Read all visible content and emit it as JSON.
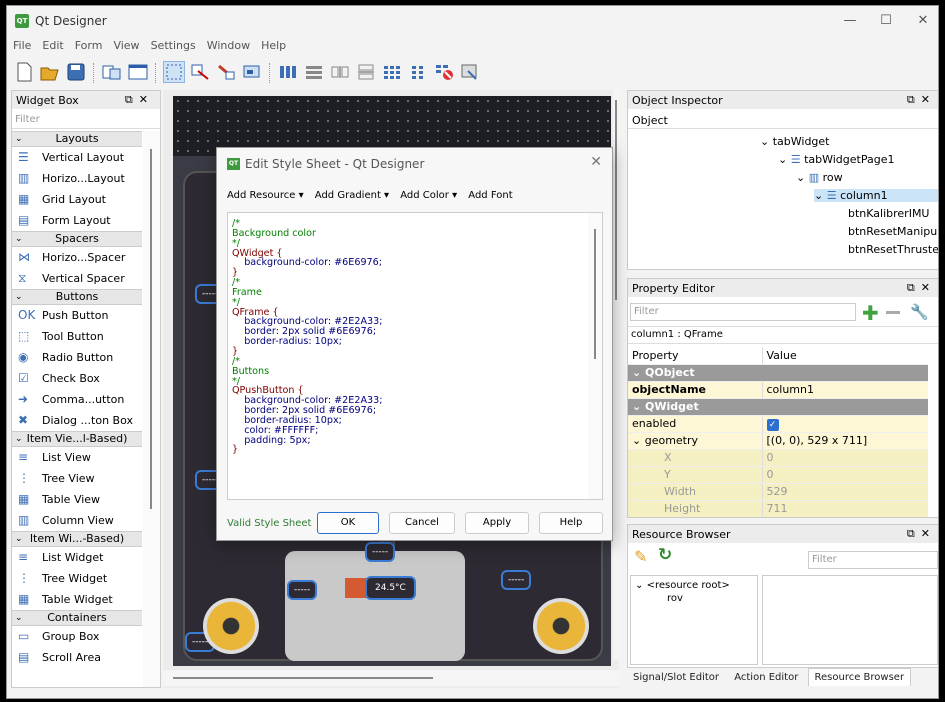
{
  "window": {
    "title": "Qt Designer",
    "minimize": "—",
    "maximize": "☐",
    "close": "✕"
  },
  "menu": [
    "File",
    "Edit",
    "Form",
    "View",
    "Settings",
    "Window",
    "Help"
  ],
  "widget_box": {
    "title": "Widget Box",
    "filter_placeholder": "Filter",
    "sections": [
      {
        "name": "Layouts",
        "items": [
          "Vertical Layout",
          "Horizo...Layout",
          "Grid Layout",
          "Form Layout"
        ]
      },
      {
        "name": "Spacers",
        "items": [
          "Horizo...Spacer",
          "Vertical Spacer"
        ]
      },
      {
        "name": "Buttons",
        "items": [
          "Push Button",
          "Tool Button",
          "Radio Button",
          "Check Box",
          "Comma...utton",
          "Dialog ...ton Box"
        ]
      },
      {
        "name": "Item Vie...l-Based)",
        "items": [
          "List View",
          "Tree View",
          "Table View",
          "Column View"
        ]
      },
      {
        "name": "Item Wi...-Based)",
        "items": [
          "List Widget",
          "Tree Widget",
          "Table Widget"
        ]
      },
      {
        "name": "Containers",
        "items": [
          "Group Box",
          "Scroll Area"
        ]
      }
    ]
  },
  "form": {
    "btn_placeholder": "-----",
    "temp": "24.5°C"
  },
  "dialog": {
    "title": "Edit Style Sheet - Qt Designer",
    "tools": [
      "Add Resource ▾",
      "Add Gradient ▾",
      "Add Color ▾",
      "Add Font"
    ],
    "valid": "Valid Style Sheet",
    "buttons": {
      "ok": "OK",
      "cancel": "Cancel",
      "apply": "Apply",
      "help": "Help"
    },
    "code": [
      [
        "c",
        "/*"
      ],
      [
        "c",
        "Background color"
      ],
      [
        "c",
        "*/"
      ],
      [
        "s",
        "QWidget {"
      ],
      [
        "p",
        "    background-color: #6E6976;"
      ],
      [
        "s",
        "}"
      ],
      [
        "c",
        "/*"
      ],
      [
        "c",
        "Frame"
      ],
      [
        "c",
        "*/"
      ],
      [
        "s",
        "QFrame {"
      ],
      [
        "p",
        "    background-color: #2E2A33;"
      ],
      [
        "p",
        "    border: 2px solid #6E6976;"
      ],
      [
        "p",
        "    border-radius: 10px;"
      ],
      [
        "s",
        "}"
      ],
      [
        "c",
        "/*"
      ],
      [
        "c",
        "Buttons"
      ],
      [
        "c",
        "*/"
      ],
      [
        "s",
        "QPushButton {"
      ],
      [
        "p",
        "    background-color: #2E2A33;"
      ],
      [
        "p",
        "    border: 2px solid #6E6976;"
      ],
      [
        "p",
        "    border-radius: 10px;"
      ],
      [
        "p",
        "    color: #FFFFFF;"
      ],
      [
        "p",
        "    padding: 5px;"
      ],
      [
        "s",
        "}"
      ]
    ]
  },
  "object_inspector": {
    "title": "Object Inspector",
    "header": "Object",
    "rows": [
      "tabWidget",
      "tabWidgetPage1",
      "row",
      "column1",
      "btnKalibrerIMU",
      "btnResetManipul",
      "btnResetThruster"
    ]
  },
  "property_editor": {
    "title": "Property Editor",
    "filter_placeholder": "Filter",
    "object_label": "column1 : QFrame",
    "col_property": "Property",
    "col_value": "Value",
    "rows": [
      {
        "type": "group",
        "name": "QObject"
      },
      {
        "type": "prop",
        "name": "objectName",
        "value": "column1",
        "bold": true
      },
      {
        "type": "group",
        "name": "QWidget"
      },
      {
        "type": "prop",
        "name": "enabled",
        "value": "",
        "check": true
      },
      {
        "type": "prop",
        "name": "geometry",
        "value": "[(0, 0), 529 x 711]",
        "expand": true
      },
      {
        "type": "sub",
        "name": "X",
        "value": "0"
      },
      {
        "type": "sub",
        "name": "Y",
        "value": "0"
      },
      {
        "type": "sub",
        "name": "Width",
        "value": "529"
      },
      {
        "type": "sub",
        "name": "Height",
        "value": "711"
      }
    ]
  },
  "resource_browser": {
    "title": "Resource Browser",
    "filter_placeholder": "Filter",
    "root": "<resource root>",
    "child": "rov"
  },
  "bottom_tabs": [
    "Signal/Slot Editor",
    "Action Editor",
    "Resource Browser"
  ]
}
